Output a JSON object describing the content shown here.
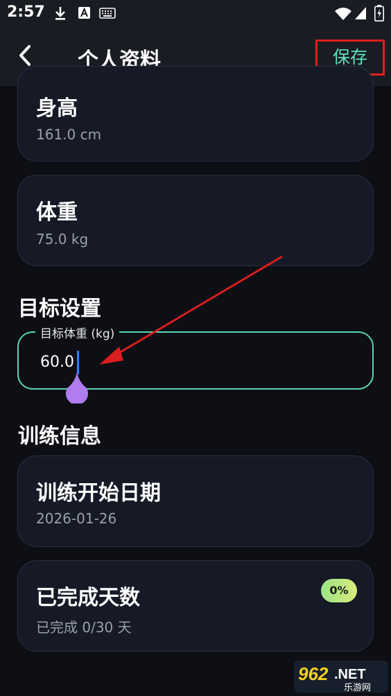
{
  "status_bar": {
    "time": "2:57"
  },
  "app_bar": {
    "title": "个人资料",
    "save_label": "保存"
  },
  "height_card": {
    "label": "身高",
    "value": "161.0 cm"
  },
  "weight_card": {
    "label": "体重",
    "value": "75.0 kg"
  },
  "goal_section": {
    "title": "目标设置",
    "target_weight_field": {
      "label": "目标体重 (kg)",
      "value": "60.0"
    }
  },
  "training_section": {
    "title": "训练信息",
    "start_date_card": {
      "label": "训练开始日期",
      "value": "2026-01-26"
    },
    "completed_days_card": {
      "label": "已完成天数",
      "value": "已完成 0/30 天",
      "progress_badge": "0%"
    }
  },
  "watermark": {
    "text": "962.NET",
    "subtext": "乐游网"
  },
  "colors": {
    "accent": "#5ee0c0",
    "highlight_box": "#e01e1e",
    "handle": "#b07cf0",
    "caret": "#2f7fff"
  },
  "icons": [
    "download-icon",
    "a-icon",
    "keyboard-icon",
    "wifi-icon",
    "signal-icon",
    "battery-icon",
    "back-arrow-icon"
  ]
}
